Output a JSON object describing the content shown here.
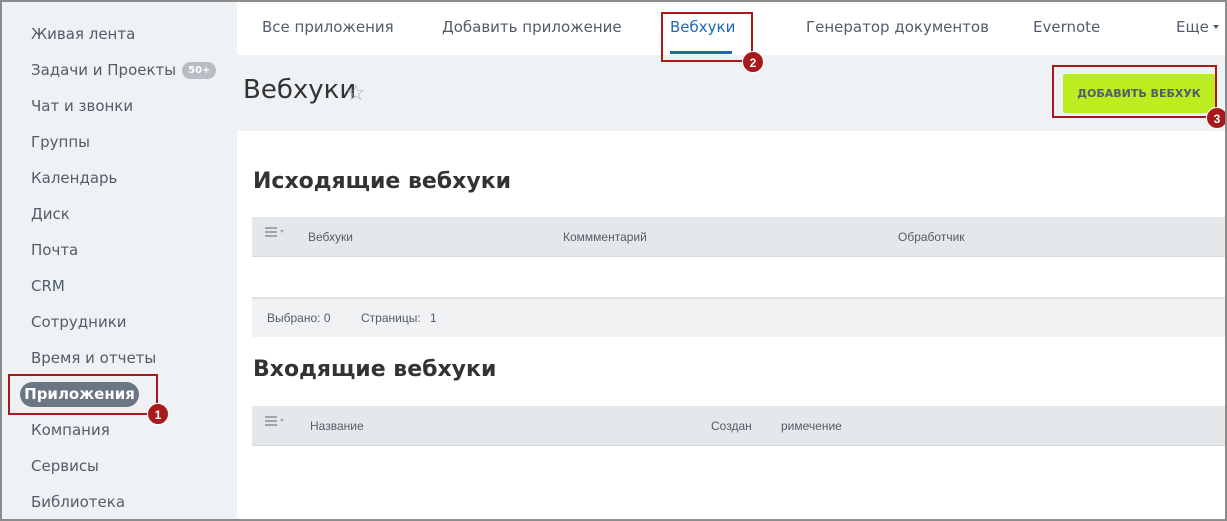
{
  "sidebar": {
    "items": [
      {
        "label": "Живая лента"
      },
      {
        "label": "Задачи и Проекты",
        "badge": "50+"
      },
      {
        "label": "Чат и звонки"
      },
      {
        "label": "Группы"
      },
      {
        "label": "Календарь"
      },
      {
        "label": "Диск"
      },
      {
        "label": "Почта"
      },
      {
        "label": "CRM"
      },
      {
        "label": "Сотрудники"
      },
      {
        "label": "Время и отчеты"
      },
      {
        "label": "Приложения",
        "active": true
      },
      {
        "label": "Компания"
      },
      {
        "label": "Сервисы"
      },
      {
        "label": "Библиотека"
      }
    ]
  },
  "tabs": [
    {
      "label": "Все приложения"
    },
    {
      "label": "Добавить приложение"
    },
    {
      "label": "Вебхуки",
      "active": true
    },
    {
      "label": "Генератор документов"
    },
    {
      "label": "Evernote"
    },
    {
      "label": "Еще"
    }
  ],
  "header": {
    "title": "Вебхуки",
    "star": "☆",
    "add_button": "ДОБАВИТЬ ВЕБХУК"
  },
  "outgoing": {
    "title": "Исходящие вебхуки",
    "columns": [
      "Вебхуки",
      "Коммментарий",
      "Обработчик"
    ],
    "footer": {
      "selected_label": "Выбрано: 0",
      "pages_label": "Страницы:",
      "pages_value": "1"
    }
  },
  "incoming": {
    "title": "Входящие вебхуки",
    "columns": [
      "Название",
      "Создан",
      "римечение"
    ]
  },
  "callouts": [
    "1",
    "2",
    "3"
  ],
  "colors": {
    "accent_green": "#bbed21",
    "active_tab": "#2067b0",
    "callout_red": "#a8191c",
    "sidebar_bg": "#eef2f4"
  }
}
